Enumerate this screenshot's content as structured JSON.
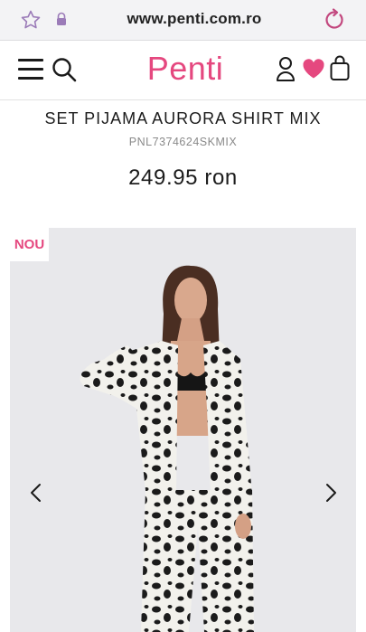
{
  "browser": {
    "url": "www.penti.com.ro",
    "icons": [
      "star-icon",
      "lock-icon",
      "reload-icon"
    ]
  },
  "header": {
    "logo": "Penti",
    "icons": [
      "menu-icon",
      "search-icon",
      "user-icon",
      "heart-icon",
      "bag-icon"
    ],
    "accent_color": "#e5487f"
  },
  "product": {
    "title": "SET PIJAMA AURORA SHIRT MIX",
    "sku": "PNL7374624SKMIX",
    "price": "249.95 ron",
    "badge": "NOU"
  },
  "gallery": {
    "icons": [
      "chevron-left-icon",
      "chevron-right-icon"
    ]
  }
}
